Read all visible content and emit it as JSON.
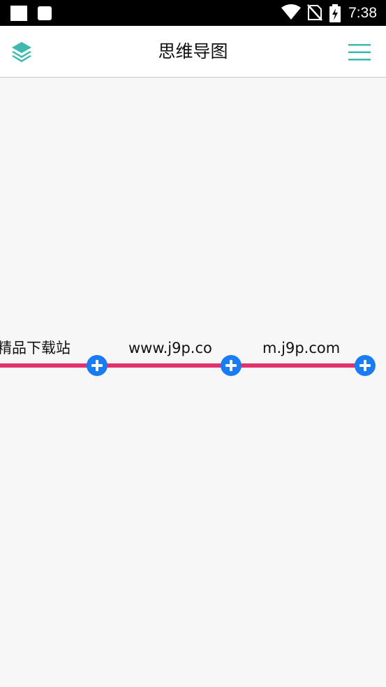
{
  "status_bar": {
    "time": "7:38",
    "icons": [
      "square-notification-icon",
      "square-notification-icon",
      "wifi-icon",
      "no-sim-icon",
      "battery-charging-icon"
    ]
  },
  "app_bar": {
    "title": "思维导图",
    "left_icon": "layers-icon",
    "right_icon": "hamburger-menu-icon"
  },
  "colors": {
    "accent": "#3fb8af",
    "line": "#e0326c",
    "add_button": "#1a7cf5",
    "background": "#f7f7f7"
  },
  "mindmap": {
    "nodes": [
      {
        "label": "精品下载站"
      },
      {
        "label": "www.j9p.co"
      },
      {
        "label": "m.j9p.com"
      }
    ]
  }
}
